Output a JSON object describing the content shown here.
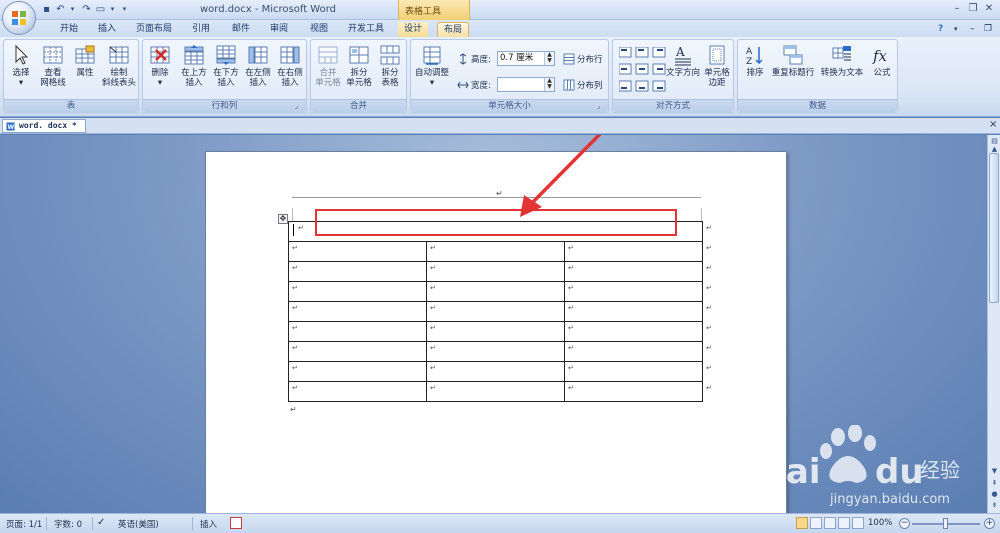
{
  "titlebar": {
    "doc_title": "word.docx - Microsoft Word",
    "context_tab_group": "表格工具",
    "minimize": "–",
    "restore": "❐",
    "close": "✕"
  },
  "tabs": [
    {
      "label": "开始"
    },
    {
      "label": "插入"
    },
    {
      "label": "页面布局"
    },
    {
      "label": "引用"
    },
    {
      "label": "邮件"
    },
    {
      "label": "审阅"
    },
    {
      "label": "视图"
    },
    {
      "label": "开发工具"
    },
    {
      "label": "设计"
    },
    {
      "label": "布局"
    }
  ],
  "ribbon_help": "?",
  "groups": {
    "table": {
      "label": "表",
      "select": "选择",
      "gridlines_1": "查看",
      "gridlines_2": "网格线",
      "properties": "属性",
      "draw_1": "绘制",
      "draw_2": "斜线表头"
    },
    "rows_cols": {
      "label": "行和列",
      "delete": "删除",
      "above_1": "在上方",
      "above_2": "插入",
      "below_1": "在下方",
      "below_2": "插入",
      "left_1": "在左侧",
      "left_2": "插入",
      "right_1": "在右侧",
      "right_2": "插入"
    },
    "merge": {
      "label": "合并",
      "merge_1": "合并",
      "merge_2": "单元格",
      "split_1": "拆分",
      "split_2": "单元格",
      "split_table_1": "拆分",
      "split_table_2": "表格"
    },
    "cell_size": {
      "label": "单元格大小",
      "autofit": "自动调整",
      "height_label": "高度:",
      "height_value": "0.7 厘米",
      "width_label": "宽度:",
      "width_value": "",
      "distribute_rows": "分布行",
      "distribute_cols": "分布列"
    },
    "alignment": {
      "label": "对齐方式",
      "text_direction": "文字方向",
      "margins_1": "单元格",
      "margins_2": "边距"
    },
    "data": {
      "label": "数据",
      "sort": "排序",
      "repeat_header": "重复标题行",
      "to_text": "转换为文本",
      "formula": "公式"
    }
  },
  "doc_tab": {
    "label": "word. docx *",
    "close": "×"
  },
  "document": {
    "para_mark": "↵",
    "table_rows": 9,
    "table_cols": 3
  },
  "statusbar": {
    "page": "页面: 1/1",
    "words": "字数: 0",
    "language": "英语(美国)",
    "mode": "插入",
    "zoom": "100%",
    "zoom_minus": "−",
    "zoom_plus": "+"
  },
  "watermark": {
    "url": "jingyan.baidu.com"
  },
  "colors": {
    "highlight": "#e23434",
    "context_tab": "#f3cf73",
    "ribbon": "#dbe6f5"
  }
}
